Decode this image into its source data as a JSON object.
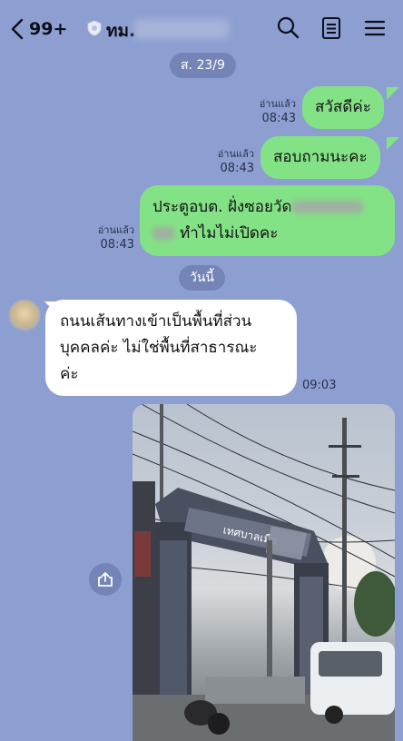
{
  "header": {
    "back_count": "99+",
    "title": "ทม.",
    "icons": [
      "back-chevron-icon",
      "search-icon",
      "notes-icon",
      "menu-icon"
    ]
  },
  "dates": {
    "sat": "ส. 23/9",
    "today": "วันนี้"
  },
  "messages": [
    {
      "side": "out",
      "text": "สวัสดีค่ะ",
      "read": "อ่านแล้ว",
      "time": "08:43"
    },
    {
      "side": "out",
      "text": "สอบถามนะคะ",
      "read": "อ่านแล้ว",
      "time": "08:43"
    },
    {
      "side": "out",
      "line1": "ประตูอบต. ฝั่งซอยวัด",
      "line2": "ทำไมไม่เปิดคะ",
      "read": "อ่านแล้ว",
      "time": "08:43"
    },
    {
      "side": "in",
      "line1": "ถนนเส้นทางเข้าเป็นพื้นที่ส่วน",
      "line2": "บุคคลค่ะ ไม่ใช่พื้นที่สาธารณะ",
      "line3": "ค่ะ",
      "time": "09:03"
    }
  ],
  "photo": {
    "sign_text": "เทศบาลเมือ"
  },
  "colors": {
    "background": "#8d9fd1",
    "bubble_out": "#84e286",
    "bubble_in": "#ffffff",
    "pill": "#7584b7"
  }
}
